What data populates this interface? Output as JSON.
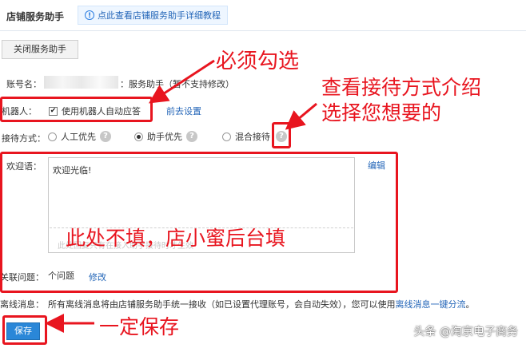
{
  "header": {
    "title": "店铺服务助手",
    "tutorial_link": "点此查看店铺服务助手详细教程"
  },
  "toolbar": {
    "close_button": "关闭服务助手"
  },
  "account": {
    "label": "账号名：",
    "suffix": "：服务助手（暂不支持修改）"
  },
  "robot": {
    "label": "机器人：",
    "checkbox_label": "使用机器人自动应答",
    "checked": true,
    "settings_link": "前去设置"
  },
  "reception": {
    "label": "接待方式：",
    "options": [
      {
        "label": "人工优先",
        "selected": false
      },
      {
        "label": "助手优先",
        "selected": true
      },
      {
        "label": "混合接待",
        "selected": false
      }
    ]
  },
  "welcome": {
    "label": "欢迎语：",
    "value": "欢迎光临!",
    "edit_link": "编辑",
    "ghost_text": "此处回复只有在接入助手接待时才生效"
  },
  "related": {
    "label": "关联问题：",
    "count_text": "个问题",
    "modify_link": "修改"
  },
  "offline": {
    "label": "离线消息：",
    "text": "所有离线消息将由店铺服务助手统一接收（如已设置代理账号，会自动失效），您可以使用",
    "link": "离线消息一键分流",
    "end": "。"
  },
  "save_button": "保存",
  "annotations": {
    "must_check": "必须勾选",
    "view_reception_line1": "查看接待方式介绍",
    "view_reception_line2": "选择您想要的",
    "leave_empty": "此处不填，店小蜜后台填",
    "must_save": "一定保存"
  },
  "watermark": "头条 @淘京电子商务",
  "colors": {
    "annotation_red": "#e8151f",
    "link_blue": "#2466b8",
    "save_blue": "#2a87d8"
  }
}
